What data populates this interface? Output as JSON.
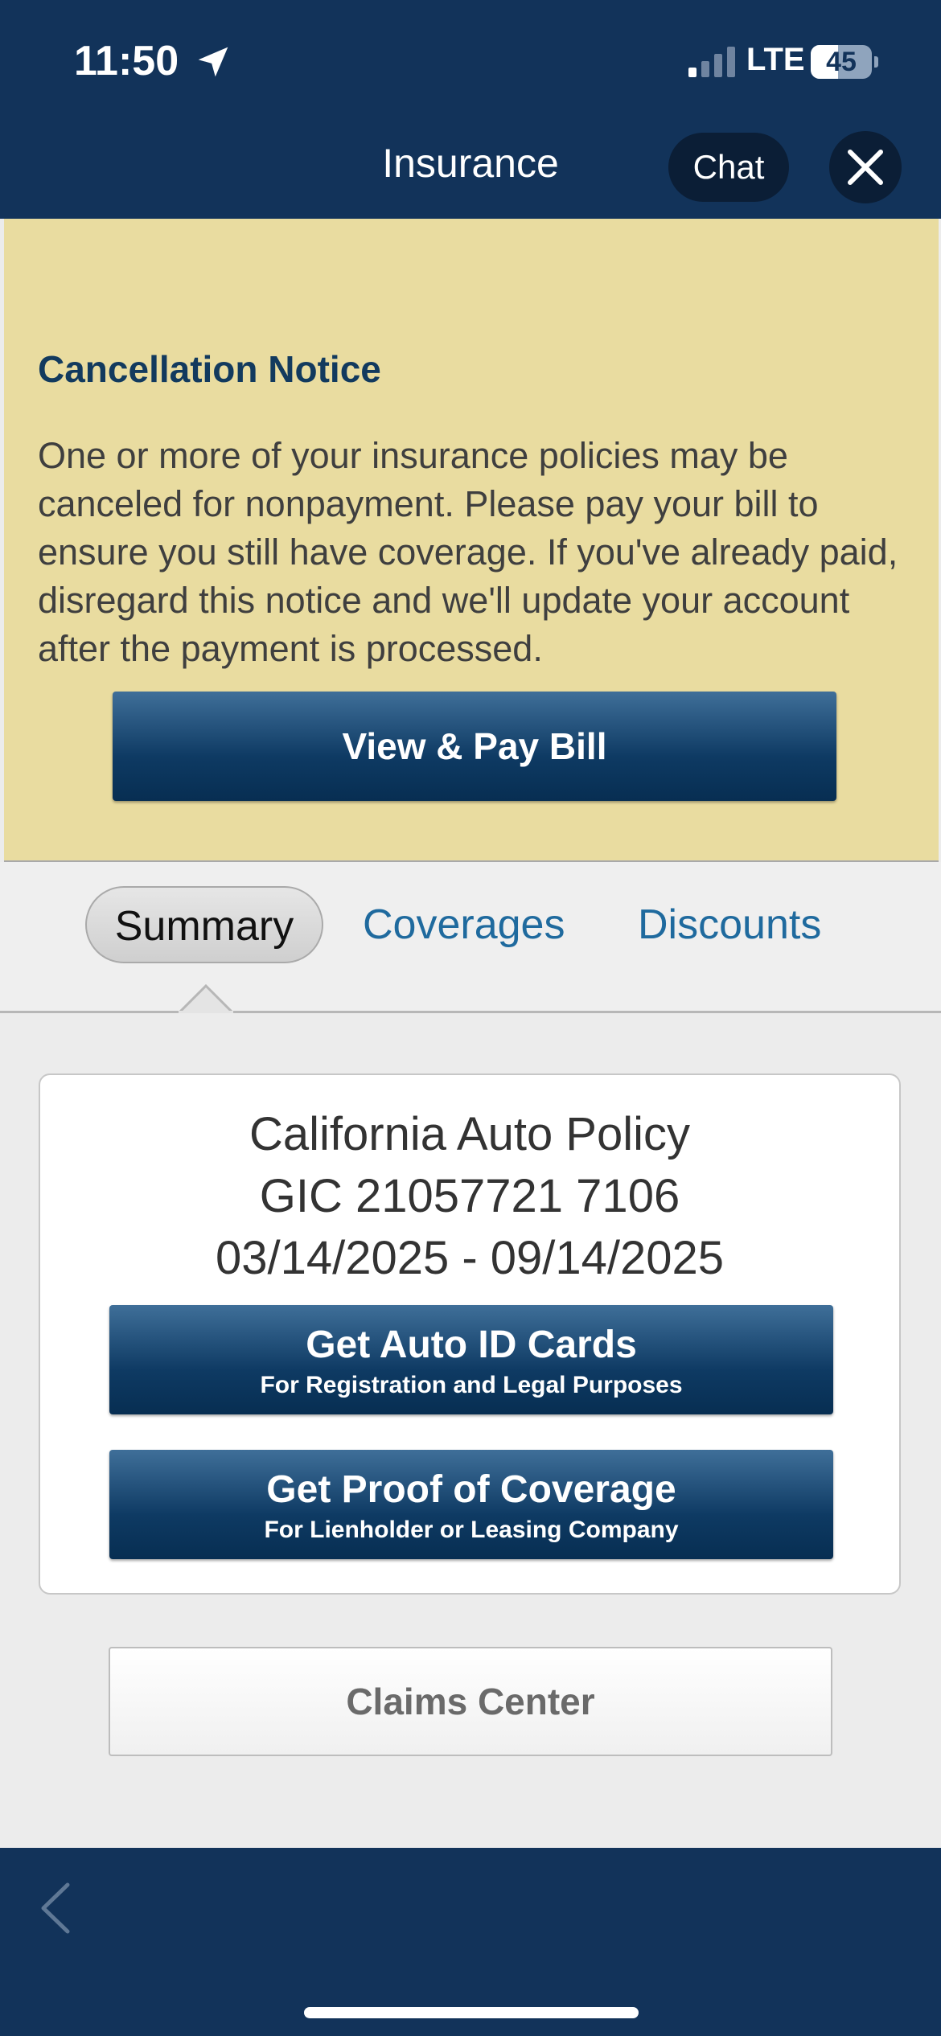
{
  "status_bar": {
    "time": "11:50",
    "network": "LTE",
    "battery_level": "45",
    "battery_fraction": 0.45
  },
  "header": {
    "title": "Insurance",
    "chat_label": "Chat"
  },
  "notice": {
    "title": "Cancellation Notice",
    "body": "One or more of your insurance policies may be canceled for nonpayment. Please pay your bill to ensure you still have coverage. If you've already paid, disregard this notice and we'll update your account after the payment is processed.",
    "button_label": "View & Pay Bill"
  },
  "tabs": [
    {
      "label": "Summary",
      "selected": true
    },
    {
      "label": "Coverages",
      "selected": false
    },
    {
      "label": "Discounts",
      "selected": false
    }
  ],
  "policy": {
    "name": "California Auto Policy",
    "number": "GIC 21057721 7106",
    "dates": "03/14/2025 - 09/14/2025",
    "auto_id_button": {
      "title": "Get Auto ID Cards",
      "subtitle": "For Registration and Legal Purposes"
    },
    "proof_button": {
      "title": "Get Proof of Coverage",
      "subtitle": "For Lienholder or Leasing Company"
    }
  },
  "claims_label": "Claims Center",
  "colors": {
    "navy": "#12335a",
    "notice_bg": "#e9dca0",
    "link_blue": "#1f6a9e"
  }
}
